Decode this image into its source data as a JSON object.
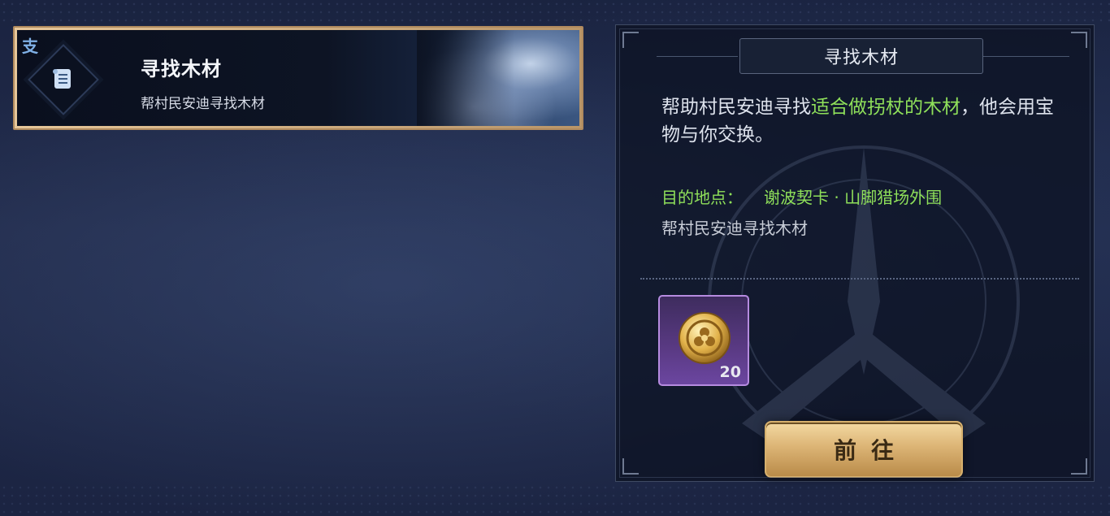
{
  "quest_list": {
    "items": [
      {
        "tag": "支",
        "title": "寻找木材",
        "subtitle": "帮村民安迪寻找木材",
        "icon": "scroll-icon"
      }
    ]
  },
  "detail": {
    "title": "寻找木材",
    "description_part1": "帮助村民安迪寻找",
    "description_highlight": "适合做拐杖的木材",
    "description_part2": "，他会用宝物与你交换。",
    "destination_label": "目的地点：",
    "destination_value": "谢波契卡 · 山脚猎场外围",
    "destination_sub": "帮村民安迪寻找木材",
    "reward": {
      "icon": "gold-coin-icon",
      "count": "20"
    },
    "go_button_label": "前往"
  },
  "colors": {
    "highlight_green": "#8fe05a",
    "card_border": "#b08a5e",
    "reward_purple": "#5a3a84",
    "button_gold": "#dcb475"
  }
}
